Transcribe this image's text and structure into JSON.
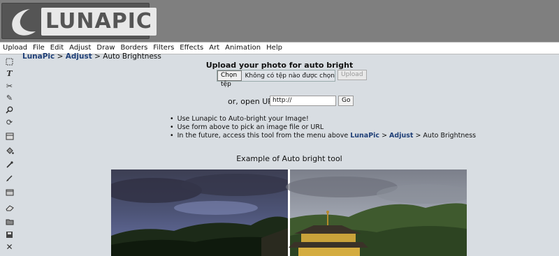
{
  "app": {
    "logo_text": "LUNAPIC"
  },
  "menu": [
    "Upload",
    "File",
    "Edit",
    "Adjust",
    "Draw",
    "Borders",
    "Filters",
    "Effects",
    "Art",
    "Animation",
    "Help"
  ],
  "toolbar": [
    "select-icon",
    "text-icon",
    "scissors-icon",
    "pencil-icon",
    "zoom-icon",
    "rotate-icon",
    "crop-icon",
    "fill-bucket-icon",
    "eyedropper-icon",
    "brush-icon",
    "layers-icon",
    "eraser-icon",
    "open-folder-icon",
    "save-icon",
    "close-icon"
  ],
  "breadcrumb": {
    "root": "LunaPic",
    "sep1": " > ",
    "section": "Adjust",
    "sep2": " > ",
    "current": "Auto Brightness"
  },
  "upload": {
    "title": "Upload your photo for auto bright",
    "file_button": "Chọn tệp",
    "file_status": "Không có tệp nào được chọn",
    "upload_button": "Upload"
  },
  "url": {
    "label": "or, open URL",
    "value": "http://",
    "go_button": "Go"
  },
  "bullets": {
    "line1": "Use Lunapic to Auto-bright your Image!",
    "line2": "Use form above to pick an image file or URL",
    "line3_prefix": "In the future, access this tool from the menu above ",
    "line3_link1": "LunaPic",
    "line3_sep1": " > ",
    "line3_link2": "Adjust",
    "line3_suffix": " > Auto Brightness"
  },
  "example": {
    "title": "Example of Auto bright tool"
  },
  "colors": {
    "header_bg": "#7f7f7f",
    "page_bg": "#d8dde2",
    "link": "#1f3f77"
  }
}
